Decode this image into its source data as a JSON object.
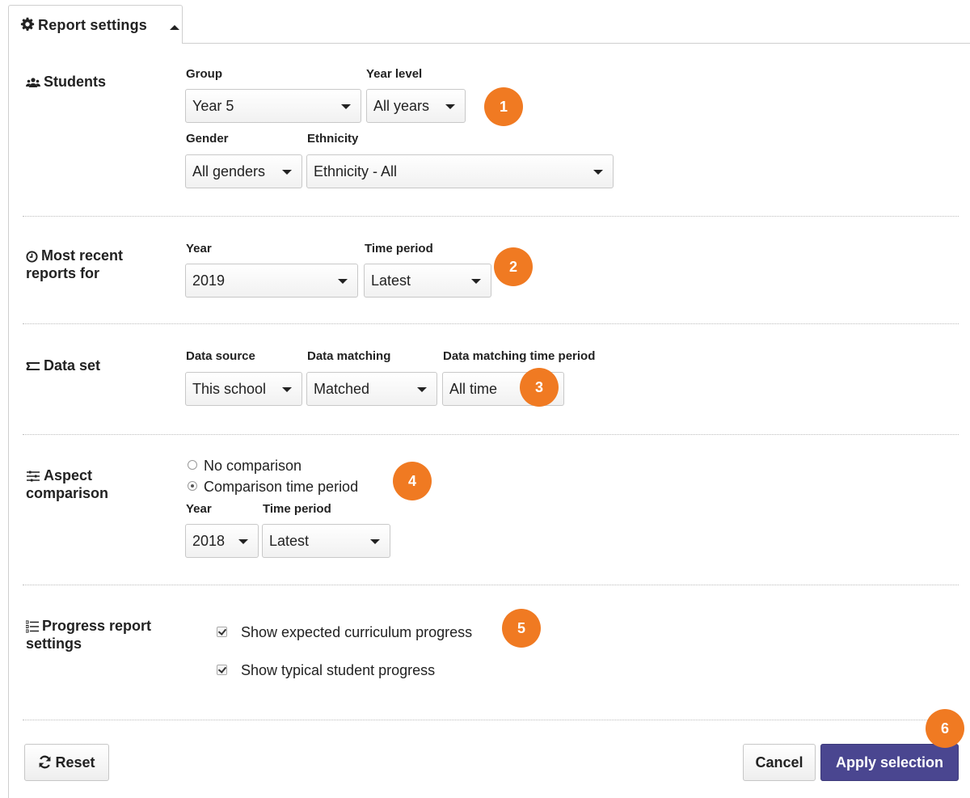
{
  "tab": {
    "title": "Report settings",
    "icon": "gear-icon"
  },
  "students": {
    "label": "Students",
    "icon": "users-icon",
    "group": {
      "label": "Group",
      "value": "Year 5"
    },
    "year_level": {
      "label": "Year level",
      "value": "All years"
    },
    "gender": {
      "label": "Gender",
      "value": "All genders"
    },
    "ethnicity": {
      "label": "Ethnicity",
      "value": "Ethnicity - All"
    },
    "badge": "1"
  },
  "recent": {
    "label_line1": "Most recent",
    "label_line2": "reports for",
    "icon": "clock-icon",
    "year": {
      "label": "Year",
      "value": "2019"
    },
    "time_period": {
      "label": "Time period",
      "value": "Latest"
    },
    "badge": "2"
  },
  "dataset": {
    "label": "Data set",
    "icon": "dataset-icon",
    "source": {
      "label": "Data source",
      "value": "This school"
    },
    "matching": {
      "label": "Data matching",
      "value": "Matched"
    },
    "matching_period": {
      "label": "Data matching time period",
      "value": "All time"
    },
    "badge": "3"
  },
  "aspect": {
    "label_line1": "Aspect",
    "label_line2": "comparison",
    "icon": "sliders-icon",
    "options": [
      "No comparison",
      "Comparison time period"
    ],
    "selected_option": "Comparison time period",
    "year": {
      "label": "Year",
      "value": "2018"
    },
    "time_period": {
      "label": "Time period",
      "value": "Latest"
    },
    "badge": "4"
  },
  "progress": {
    "label_line1": "Progress report",
    "label_line2": "settings",
    "icon": "list-icon",
    "checks": [
      {
        "label": "Show expected curriculum progress",
        "checked": true
      },
      {
        "label": "Show typical student progress",
        "checked": true
      }
    ],
    "badge": "5"
  },
  "footer": {
    "reset_label": "Reset",
    "cancel_label": "Cancel",
    "apply_label": "Apply selection",
    "badge": "6"
  },
  "colors": {
    "accent": "#f07a22",
    "primary": "#4a4690"
  }
}
